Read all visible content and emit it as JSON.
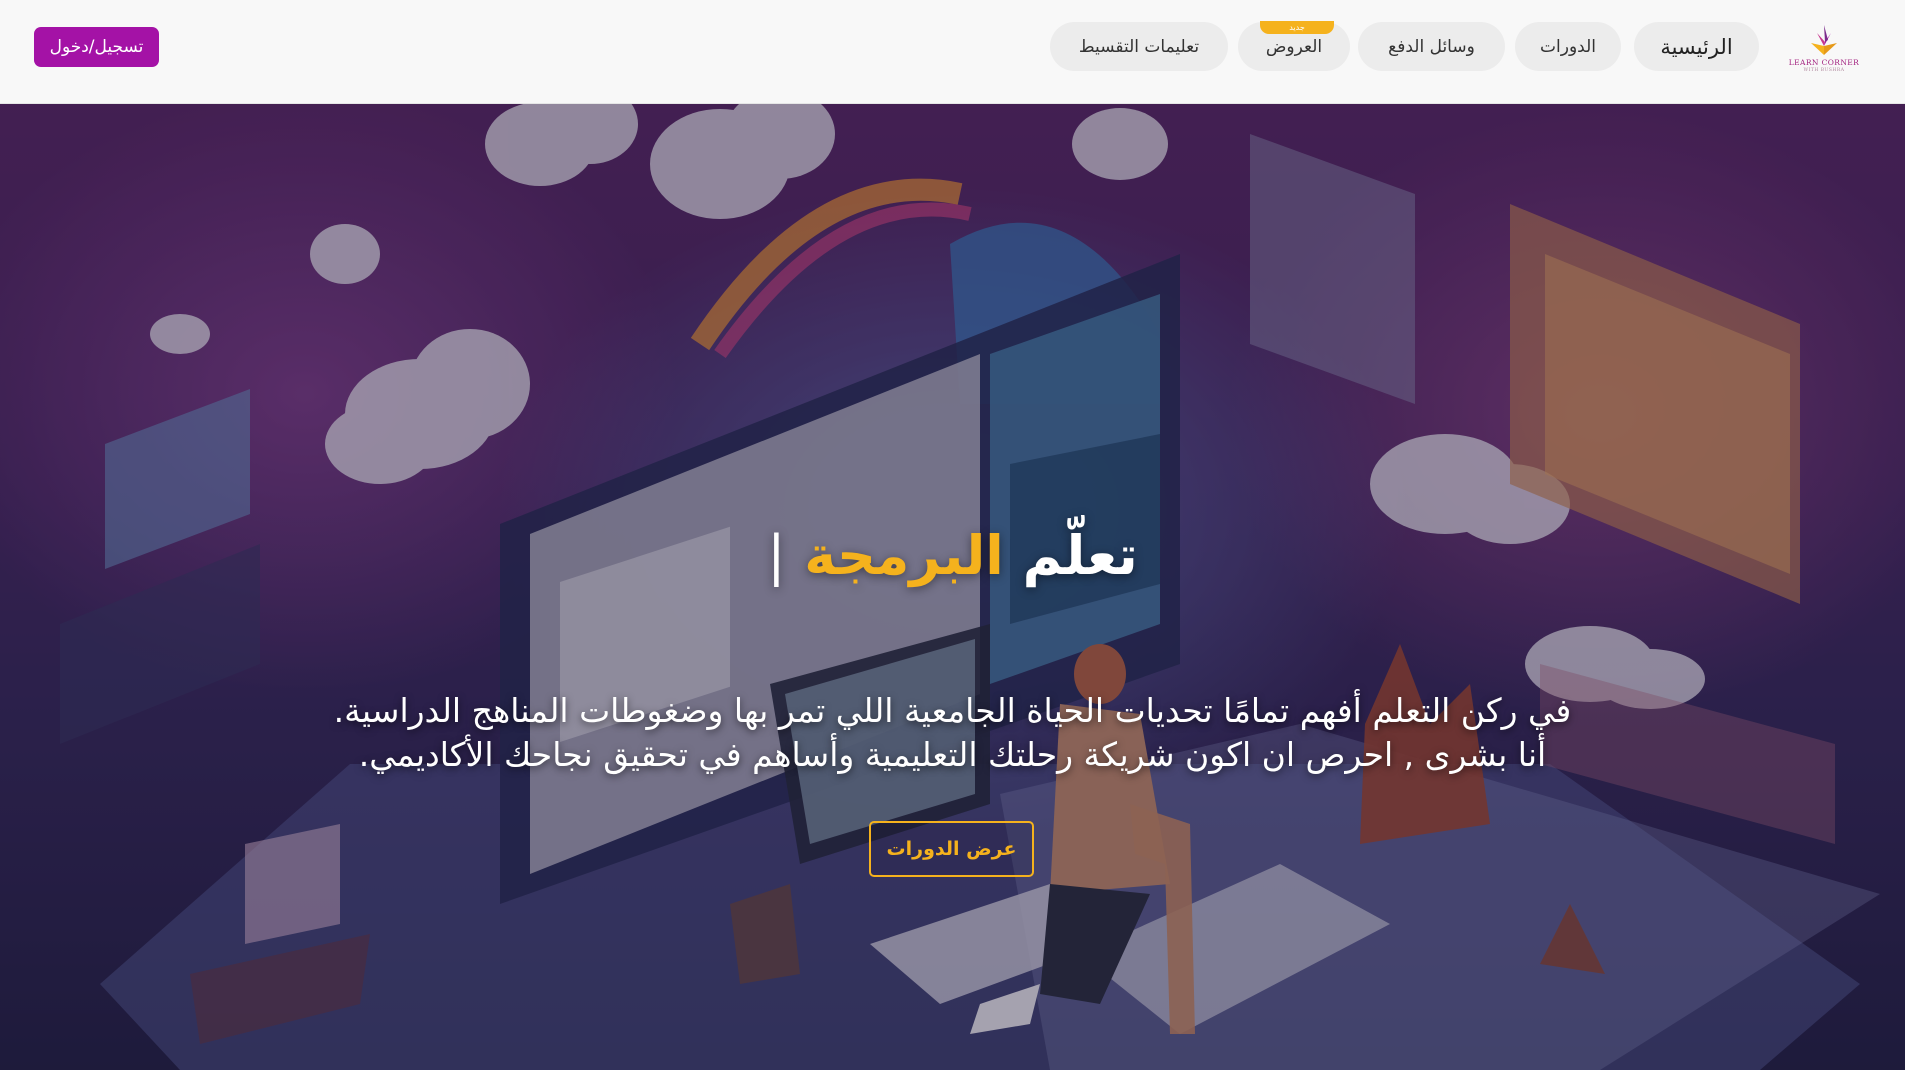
{
  "brand": {
    "name": "LEARN CORNER",
    "tagline": "WITH BUSHRA"
  },
  "nav": {
    "items": [
      {
        "label": "الرئيسية",
        "active": true
      },
      {
        "label": "الدورات"
      },
      {
        "label": "وسائل الدفع"
      },
      {
        "label": "العروض",
        "badge": "جديد"
      },
      {
        "label": "تعليمات التقسيط"
      }
    ],
    "login_label": "تسجيل/دخول"
  },
  "hero": {
    "title_prefix": "تعلّم",
    "title_highlight": "البرمجة",
    "title_cursor": "|",
    "description_line1": "في ركن التعلم أفهم تمامًا تحديات الحياة الجامعية اللي تمر بها وضغوطات المناهج الدراسية.",
    "description_line2": "أنا بشرى , احرص ان اكون شريكة رحلتك التعليمية وأساهم في تحقيق نجاحك الأكاديمي.",
    "cta_label": "عرض الدورات"
  },
  "colors": {
    "accent": "#f5b21d",
    "brand_purple": "#a412a6",
    "nav_background": "#f8f8f8",
    "pill_background": "#ececec"
  },
  "icons": [
    "book-logo-icon"
  ]
}
